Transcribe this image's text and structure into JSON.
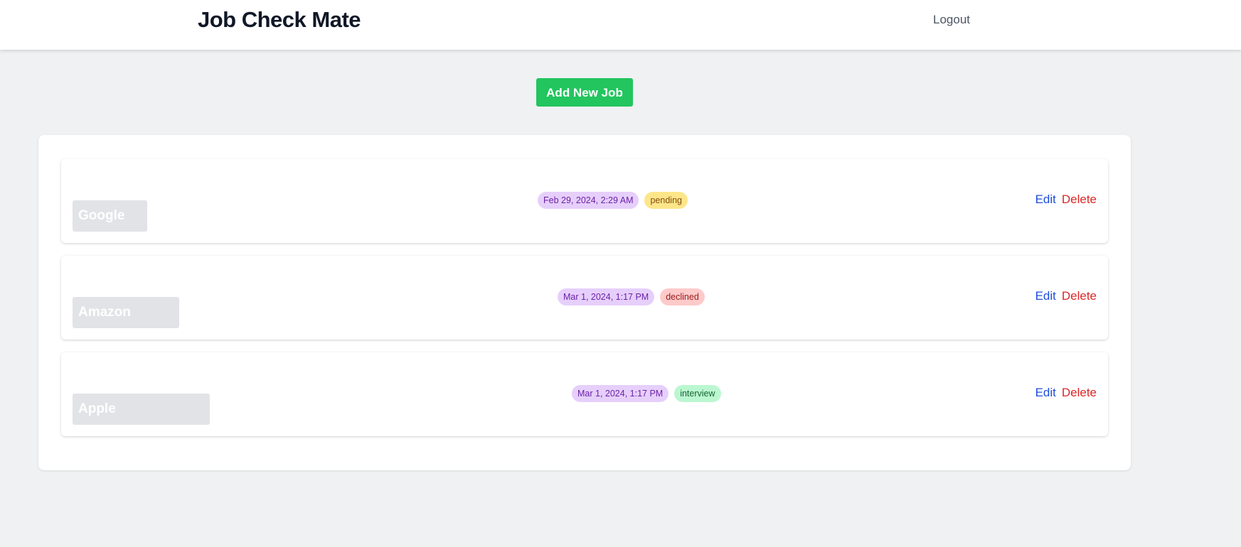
{
  "header": {
    "title": "Job Check Mate",
    "logout_label": "Logout"
  },
  "toolbar": {
    "add_job_label": "Add New Job"
  },
  "jobs": [
    {
      "company": "Google",
      "date": "Feb 29, 2024, 2:29 AM",
      "status": "pending",
      "edit_label": "Edit",
      "delete_label": "Delete"
    },
    {
      "company": "Amazon",
      "date": "Mar 1, 2024, 1:17 PM",
      "status": "declined",
      "edit_label": "Edit",
      "delete_label": "Delete"
    },
    {
      "company": "Apple",
      "date": "Mar 1, 2024, 1:17 PM",
      "status": "interview",
      "edit_label": "Edit",
      "delete_label": "Delete"
    }
  ],
  "colors": {
    "background": "#f0f1f3",
    "add_button": "#22c55e",
    "date_badge": "#e6cffb",
    "pending": "#fde68a",
    "declined": "#fecaca",
    "interview": "#bbf7d0",
    "edit": "#1d4ed8",
    "delete": "#dc2626"
  }
}
